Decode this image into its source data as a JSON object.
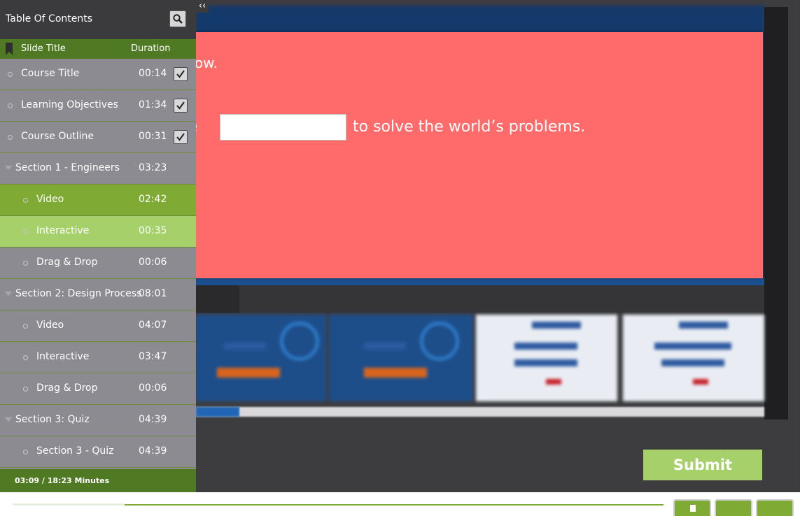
{
  "toc": {
    "title": "Table Of Contents",
    "search_icon": "search-icon",
    "collapse_label": "‹‹",
    "columns": {
      "title": "Slide Title",
      "duration": "Duration"
    },
    "items": [
      {
        "label": "Course Title",
        "duration": "00:14",
        "level": 1,
        "checked": true
      },
      {
        "label": "Learning Objectives",
        "duration": "01:34",
        "level": 1,
        "checked": true
      },
      {
        "label": "Course Outline",
        "duration": "00:31",
        "level": 1,
        "checked": true
      },
      {
        "label": "Section 1 - Engineers",
        "duration": "03:23",
        "level": 0
      },
      {
        "label": "Video",
        "duration": "02:42",
        "level": 2,
        "state": "current"
      },
      {
        "label": "Interactive",
        "duration": "00:35",
        "level": 2,
        "state": "selected"
      },
      {
        "label": "Drag & Drop",
        "duration": "00:06",
        "level": 2
      },
      {
        "label": "Section 2: Design Process",
        "duration": "08:01",
        "level": 0
      },
      {
        "label": "Video",
        "duration": "04:07",
        "level": 2
      },
      {
        "label": "Interactive",
        "duration": "03:47",
        "level": 2
      },
      {
        "label": "Drag & Drop",
        "duration": "00:06",
        "level": 2
      },
      {
        "label": "Section 3: Quiz",
        "duration": "04:39",
        "level": 0
      },
      {
        "label": "Section 3 - Quiz",
        "duration": "04:39",
        "level": 2
      }
    ],
    "footer": "03:09 / 18:23 Minutes"
  },
  "slide": {
    "prompt_line1": "elow.",
    "prompt_before_blank": "te",
    "prompt_after_blank": "to solve the world’s problems.",
    "blank_value": "",
    "submit_label": "Submit"
  },
  "colors": {
    "toc_green": "#4f7a23",
    "current_green": "#7fab35",
    "selected_green": "#a6d06a",
    "panel_red": "#ff6b6b"
  }
}
